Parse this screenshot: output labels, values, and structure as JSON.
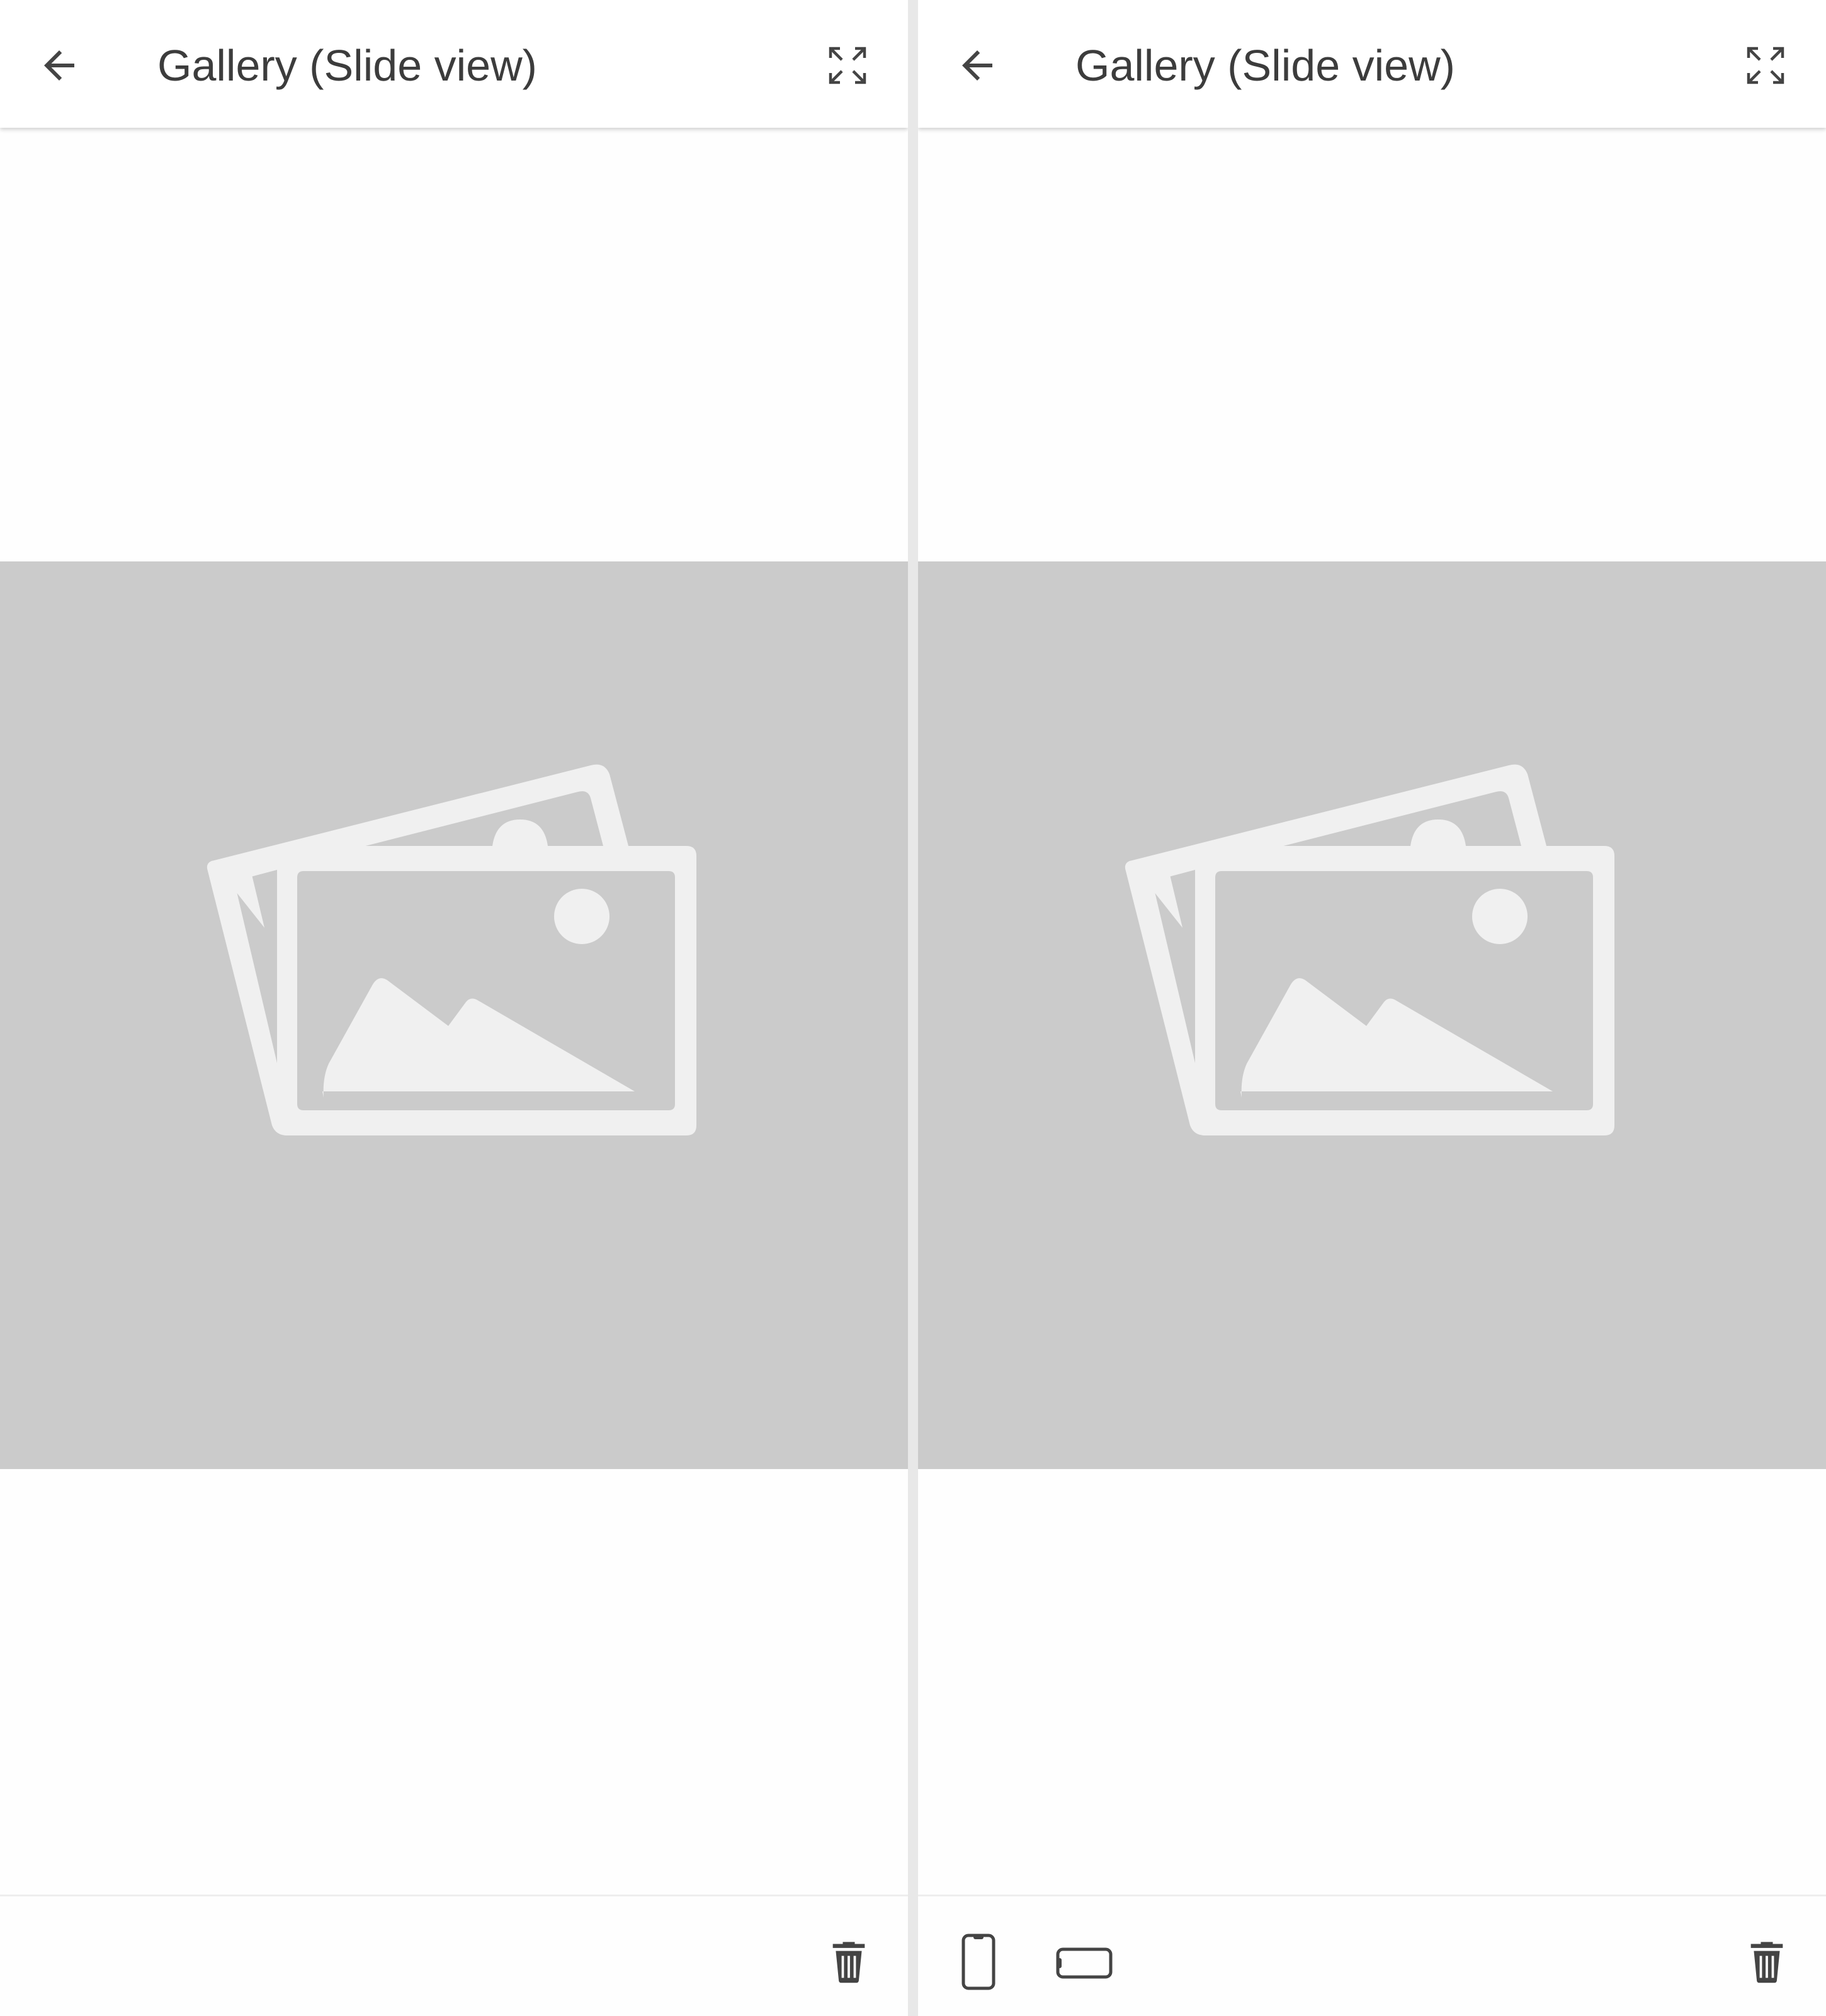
{
  "screens": [
    {
      "appbar": {
        "title": "Gallery (Slide view)",
        "back_icon": "arrow-back-icon",
        "fullscreen_icon": "fullscreen-icon"
      },
      "slide": {
        "image_icon": "image-placeholder-icon"
      },
      "bottombar": {
        "actions": [
          "delete-icon"
        ]
      }
    },
    {
      "appbar": {
        "title": "Gallery (Slide view)",
        "back_icon": "arrow-back-icon",
        "fullscreen_icon": "fullscreen-icon"
      },
      "slide": {
        "image_icon": "image-placeholder-icon"
      },
      "bottombar": {
        "actions": [
          "phone-portrait-icon",
          "phone-landscape-icon",
          "delete-icon"
        ]
      }
    }
  ],
  "colors": {
    "appbar_bg": "#ffffff",
    "text": "#3c3c3c",
    "icon": "#444444",
    "slide_bg": "#cbcbcb",
    "placeholder": "#f0f0f0"
  }
}
